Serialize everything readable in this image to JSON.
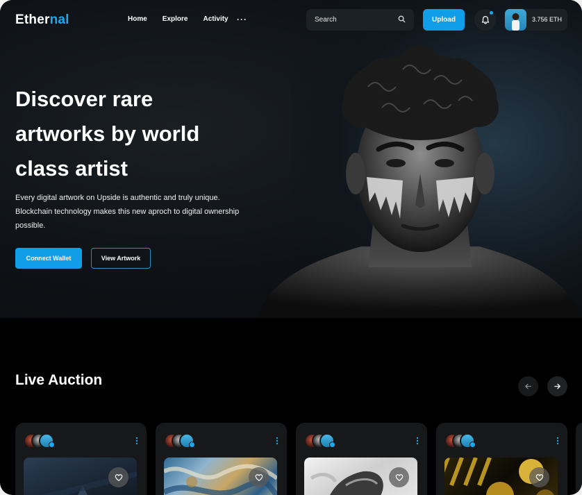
{
  "header": {
    "logo_main": "Ether",
    "logo_accent": "nal",
    "nav": [
      "Home",
      "Explore",
      "Activity"
    ],
    "more": "···",
    "search_placeholder": "Search",
    "upload_label": "Upload",
    "balance": "3.756 ETH"
  },
  "hero": {
    "title": "Discover rare artworks by world class artist",
    "subtitle": "Every digital artwork on Upside is authentic and truly unique. Blockchain technology makes this new aproch to digital ownership possible.",
    "primary_button": "Connect Wallet",
    "secondary_button": "View Artwork"
  },
  "auction": {
    "title": "Live Auction",
    "cards": [
      {
        "art": "dark-blue-abstract"
      },
      {
        "art": "blue-gold-marble"
      },
      {
        "art": "white-sculpture"
      },
      {
        "art": "gold-black-spheres"
      }
    ]
  },
  "colors": {
    "accent": "#109ee8",
    "background": "#000000",
    "card": "#16181a"
  }
}
